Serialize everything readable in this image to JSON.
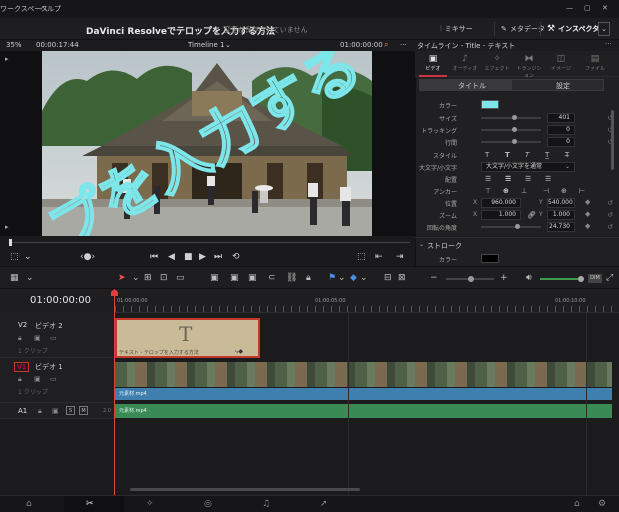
{
  "menu": {
    "workspace": "ワークスペース",
    "help": "ヘルプ"
  },
  "titlebar": {
    "project_title": "DaVinci Resolveでテロップを入力する方法",
    "unsaved": "変更が保存されていません",
    "mixer": "ミキサー",
    "metadata": "メタデータ",
    "inspector": "インスペクタ"
  },
  "viewer": {
    "zoom": "35%",
    "source_tc": "00:00:17:44",
    "timeline_name": "Timeline 1",
    "record_tc": "01:00:00:00",
    "overlay_text": "プを入力する"
  },
  "inspector": {
    "header": "タイムライン - Title - テキスト",
    "tabs": [
      "ビデオ",
      "オーディオ",
      "エフェクト",
      "トランジション",
      "イメージ",
      "ファイル"
    ],
    "subtabs": {
      "title": "タイトル",
      "settings": "設定"
    },
    "props": {
      "color_label": "カラー",
      "color_value": "#7de6ea",
      "size_label": "サイズ",
      "size_value": "401",
      "tracking_label": "トラッキング",
      "tracking_value": "0",
      "linespacing_label": "行間",
      "linespacing_value": "0",
      "style_label": "スタイル",
      "case_label": "大文字/小文字",
      "case_value": "大文字/小文字を通常",
      "align_label": "配置",
      "anchor_label": "アンカー",
      "position_label": "位置",
      "pos_x_label": "X",
      "pos_x": "960.000",
      "pos_y_label": "Y",
      "pos_y": "540.000",
      "zoom_label": "ズーム",
      "zoom_x_label": "X",
      "zoom_x": "1.000",
      "zoom_y_label": "Y",
      "zoom_y": "1.000",
      "rotation_label": "回転の角度",
      "rotation_value": "24.730",
      "stroke_section": "ストローク",
      "stroke_color_label": "カラー"
    }
  },
  "timeline": {
    "timecode": "01:00:00:00",
    "ruler": [
      "01:00:00:00",
      "01:00:05:00",
      "01:00:10:00"
    ],
    "tracks": [
      {
        "id": "V2",
        "name": "ビデオ 2",
        "clips": "1 クリップ"
      },
      {
        "id": "V1",
        "name": "ビデオ 1",
        "clips": "1 クリップ"
      },
      {
        "id": "A1",
        "name": "",
        "level": "2.0"
      }
    ],
    "title_clip_letter": "T",
    "title_clip_label": "テキスト - テロップを入力する方法",
    "video_clip_label": "元素材.mp4",
    "video_audio_label": "元素材.mp4",
    "audio_clip_label": "元素材.mp4"
  }
}
